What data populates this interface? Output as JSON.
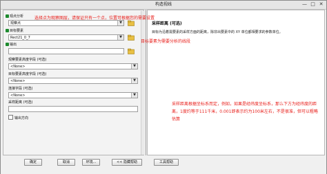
{
  "window": {
    "title": "构造视线",
    "min_label": "—",
    "max_label": "□",
    "close_label": "✕"
  },
  "form": {
    "observer_points": {
      "label": "观点分析",
      "value": "观察点"
    },
    "target_features": {
      "label": "目标要素",
      "value": "Rect21_0_7"
    },
    "output": {
      "label": "输出",
      "value": ""
    },
    "observer_height_field": {
      "label": "观察要素高度字段 (可选)",
      "value": "<None>"
    },
    "target_height_field": {
      "label": "目标要素高度字段 (可选)",
      "value": "<None>"
    },
    "join_field": {
      "label": "连接字段 (可选)",
      "value": "<None>"
    },
    "sampling_distance": {
      "label": "采样距离 (可选)",
      "value": ""
    },
    "output_option": {
      "label": "输出方向",
      "checked": false
    }
  },
  "annotations": {
    "top": "选择点为观察图层，请保证只有一个点，位置可根据您的需要设置",
    "middle": "目标要素为需要分析的线段",
    "bottom": "采样距离根据坐标系而定，例如，如果是经纬度坐标系，那么下方为经纬度的距离，1度约等于111千米，0.001即表示约为100米左右，不是很准，但可以粗略估算"
  },
  "help": {
    "title": "采样距离 (可选)",
    "body": "目标为沿着需要素的采样方面的距离，除非出要素中的 XY 单位都相要求的参数单位。"
  },
  "buttons": {
    "ok": "确定",
    "cancel": "取消",
    "env": "环境...",
    "hide_help": "<< 隐藏帮助",
    "tool_help": "工具帮助"
  },
  "colors": {
    "annotation": "#e8201c",
    "folder": "#e9c043",
    "ok_dot": "#1d8a2e"
  }
}
